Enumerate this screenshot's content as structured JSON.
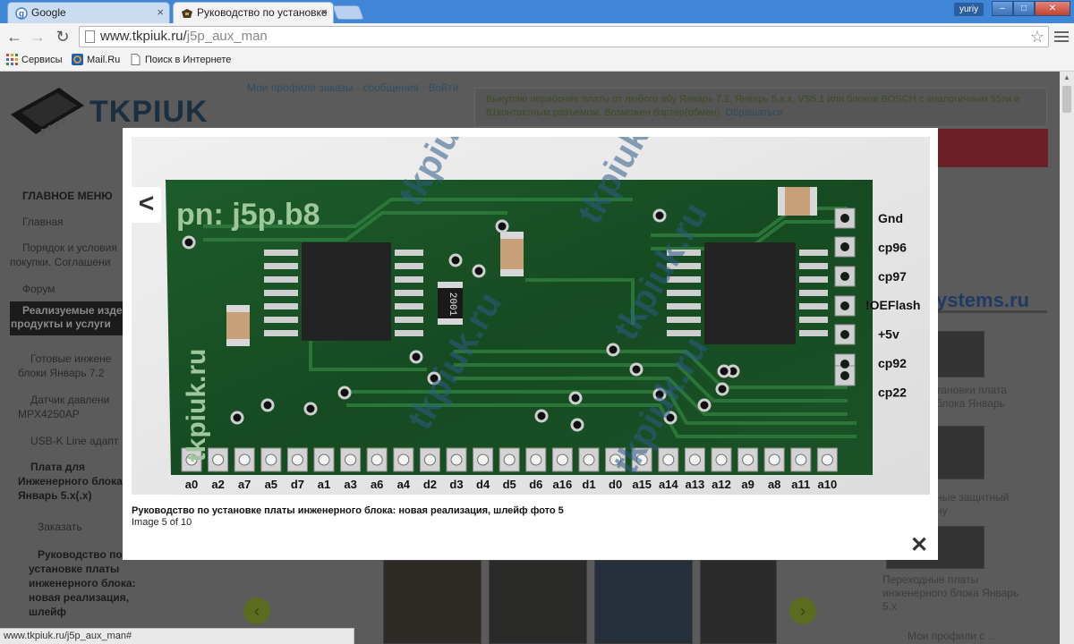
{
  "browser": {
    "tabs": [
      {
        "title": "Google",
        "active": false
      },
      {
        "title": "Руководство по установке",
        "active": true
      }
    ],
    "user": "yuriy",
    "window_buttons": {
      "minimize": "–",
      "maximize": "□",
      "close": "✕"
    },
    "url_host": "www.tkpiuk.ru/",
    "url_path": "j5p_aux_man",
    "bookmarks": [
      "Сервисы",
      "Mail.Ru",
      "Поиск в Интернете"
    ]
  },
  "page": {
    "logo": "TKPIUK",
    "top_links": "Мои профили заказы · сообщения · Войти",
    "promo_text": "Выкуплю нерабочие платы от любого абу Январь 7.2, Январь 5.х.х, VS5.1 или блоков BOSCH с аналогичным 55ти и 81контактным разъемом. Возможен бартер(обмен).",
    "promo_link": "Обращаться",
    "menu": {
      "heading": "ГЛАВНОЕ МЕНЮ",
      "items": [
        "Главная",
        "Порядок и условия",
        "покупки. Соглашени",
        "Форум",
        "Реализуемые изде",
        "продукты и услуги",
        "Готовые инжене",
        "блоки Январь 7.2",
        "Датчик давлени",
        "MPX4250AP",
        "USB-K Line адапт",
        "Плата для",
        "Инженерного блока",
        "Январь 5.х(.х)",
        "Заказать",
        "Руководство по",
        "установке платы",
        "инженерного блока:",
        "новая реализация,",
        "шлейф"
      ]
    },
    "right_ad": "ystems.ru",
    "right_captions": [
      "тановки плата",
      "блока Январь",
      "ные защитный",
      "ну",
      "Переходные платы",
      "инженерного блока Январь",
      "5.х",
      "Мои профили с ..."
    ],
    "nav_prev": "‹",
    "nav_next": "›"
  },
  "lightbox": {
    "prev_label": "<",
    "caption": "Руководство по установке платы инженерного блока: новая реализация, шлейф фото 5",
    "counter": "Image 5 of 10",
    "close_label": "✕",
    "photo": {
      "board_marking": "pn: j5p.b8",
      "side_label": "tkpiuk.ru",
      "chip_label": "2001",
      "watermarks": [
        "tkpiuk.ru",
        "tkpiuk.ru",
        "tkpiuk.ru",
        "tkpiuk.ru",
        "tkpiuk.ru"
      ],
      "right_pins": [
        "Gnd",
        "cp96",
        "cp97",
        "!OEFlash",
        "+5v",
        "cp92",
        "cp22"
      ],
      "bottom_pins": [
        "a0",
        "a2",
        "a7",
        "a5",
        "d7",
        "a1",
        "a3",
        "a6",
        "a4",
        "d2",
        "d3",
        "d4",
        "d5",
        "d6",
        "a16",
        "d1",
        "d0",
        "a15",
        "a14",
        "a13",
        "a12",
        "a9",
        "a8",
        "a11",
        "a10"
      ]
    }
  },
  "status_url": "www.tkpiuk.ru/j5p_aux_man#"
}
